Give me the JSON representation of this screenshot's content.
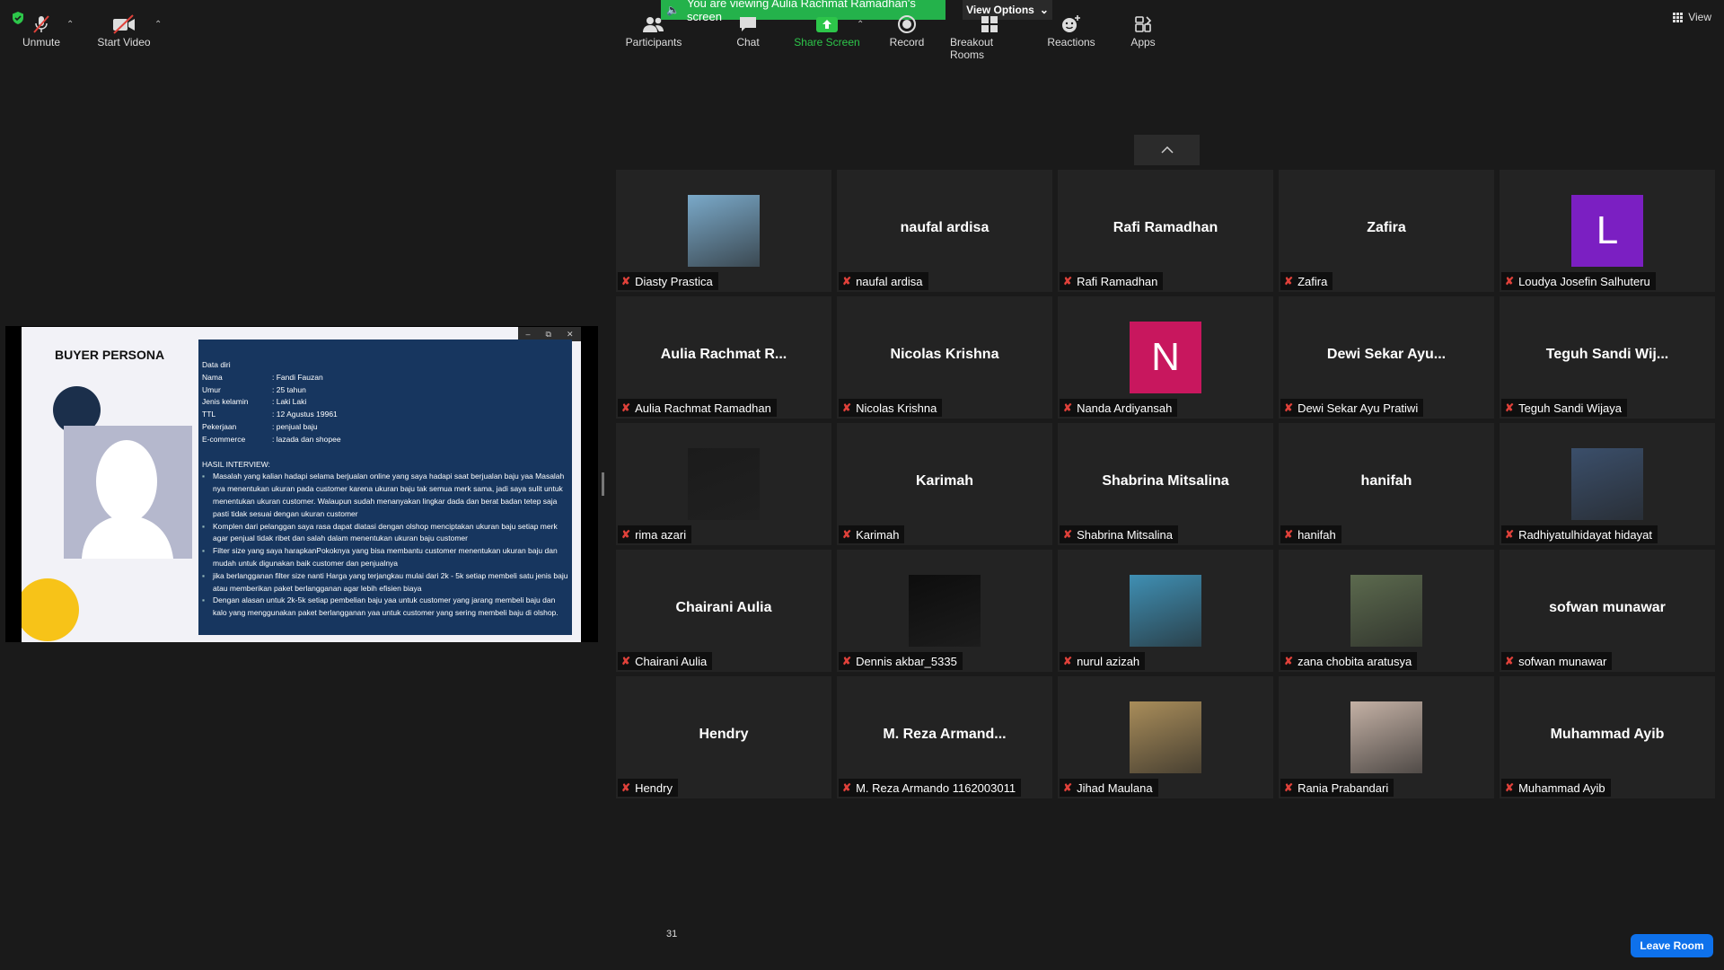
{
  "top": {
    "banner_text": "You are viewing Aulia Rachmat Ramadhan's screen",
    "view_options_label": "View Options",
    "view_label": "View"
  },
  "shared_screen": {
    "title": "BUYER PERSONA",
    "section_data": "Data diri",
    "fields": [
      {
        "key": "Nama",
        "value": ": Fandi Fauzan"
      },
      {
        "key": "Umur",
        "value": ": 25 tahun"
      },
      {
        "key": "Jenis kelamin",
        "value": ": Laki Laki"
      },
      {
        "key": "TTL",
        "value": ": 12 Agustus 19961"
      },
      {
        "key": "Pekerjaan",
        "value": ": penjual baju"
      },
      {
        "key": "E-commerce",
        "value": ": lazada dan shopee"
      }
    ],
    "interview_heading": "HASIL INTERVIEW:",
    "bullets": [
      "Masalah yang kalian hadapi selama berjualan online yang saya hadapi saat berjualan baju yaa Masalah nya menentukan ukuran pada customer karena ukuran baju tak semua merk sama, jadi saya sulit untuk menentukan ukuran customer. Walaupun sudah menanyakan lingkar dada dan berat badan tetep saja pasti tidak sesuai dengan ukuran customer",
      "Komplen dari pelanggan saya rasa dapat diatasi dengan olshop menciptakan ukuran baju setiap merk agar penjual tidak ribet dan salah dalam menentukan ukuran baju customer",
      "Filter size yang saya harapkanPokoknya yang bisa membantu customer menentukan ukuran baju dan mudah untuk digunakan baik customer dan penjualnya",
      "jika berlangganan filter size nanti Harga yang terjangkau mulai dari 2k - 5k setiap membeli satu jenis baju atau memberikan paket berlangganan agar lebih efisien biaya",
      "Dengan alasan untuk 2k-5k setiap pembelian baju yaa untuk customer yang jarang membeli baju dan kalo yang menggunakan paket berlangganan yaa untuk customer yang sering membeli baju di olshop."
    ]
  },
  "participants": [
    {
      "name": "Diasty Prastica",
      "display": "",
      "type": "photo",
      "color": "#7aa9c9"
    },
    {
      "name": "naufal ardisa",
      "display": "naufal ardisa",
      "type": "name"
    },
    {
      "name": "Rafi Ramadhan",
      "display": "Rafi Ramadhan",
      "type": "name"
    },
    {
      "name": "Zafira",
      "display": "Zafira",
      "type": "name"
    },
    {
      "name": "Loudya Josefin Salhuteru",
      "display": "L",
      "type": "letter",
      "color": "#7b1fc2"
    },
    {
      "name": "Aulia Rachmat Ramadhan",
      "display": "Aulia Rachmat R...",
      "type": "name"
    },
    {
      "name": "Nicolas Krishna",
      "display": "Nicolas Krishna",
      "type": "name"
    },
    {
      "name": "Nanda Ardiyansah",
      "display": "N",
      "type": "letter",
      "color": "#c8175e"
    },
    {
      "name": "Dewi Sekar Ayu Pratiwi",
      "display": "Dewi Sekar Ayu...",
      "type": "name"
    },
    {
      "name": "Teguh Sandi Wijaya",
      "display": "Teguh Sandi Wij...",
      "type": "name"
    },
    {
      "name": "rima azari",
      "display": "",
      "type": "photo",
      "color": "#1b1b1b"
    },
    {
      "name": "Karimah",
      "display": "Karimah",
      "type": "name"
    },
    {
      "name": "Shabrina Mitsalina",
      "display": "Shabrina Mitsalina",
      "type": "name"
    },
    {
      "name": "hanifah",
      "display": "hanifah",
      "type": "name"
    },
    {
      "name": "Radhiyatulhidayat hidayat",
      "display": "",
      "type": "photo",
      "color": "#3b4f6b"
    },
    {
      "name": "Chairani Aulia",
      "display": "Chairani Aulia",
      "type": "name"
    },
    {
      "name": "Dennis akbar_5335",
      "display": "",
      "type": "photo",
      "color": "#0d0d0d"
    },
    {
      "name": "nurul azizah",
      "display": "",
      "type": "photo",
      "color": "#3f8fb3"
    },
    {
      "name": "zana chobita aratusya",
      "display": "",
      "type": "photo",
      "color": "#5c6a4e"
    },
    {
      "name": "sofwan munawar",
      "display": "sofwan munawar",
      "type": "name"
    },
    {
      "name": "Hendry",
      "display": "Hendry",
      "type": "name"
    },
    {
      "name": "M. Reza Armando 1162003011",
      "display": "M. Reza Armand...",
      "type": "name"
    },
    {
      "name": "Jihad Maulana",
      "display": "",
      "type": "photo",
      "color": "#a98d5a"
    },
    {
      "name": "Rania Prabandari",
      "display": "",
      "type": "photo",
      "color": "#c4b1a5"
    },
    {
      "name": "Muhammad Ayib",
      "display": "Muhammad Ayib",
      "type": "name"
    }
  ],
  "toolbar": {
    "unmute": "Unmute",
    "start_video": "Start Video",
    "participants": "Participants",
    "participants_count": "31",
    "chat": "Chat",
    "share_screen": "Share Screen",
    "record": "Record",
    "breakout_rooms": "Breakout Rooms",
    "reactions": "Reactions",
    "apps": "Apps",
    "leave": "Leave Room"
  },
  "colors": {
    "share_green": "#24b24b",
    "leave_blue": "#0e71eb",
    "muted_red": "#e0413a"
  }
}
